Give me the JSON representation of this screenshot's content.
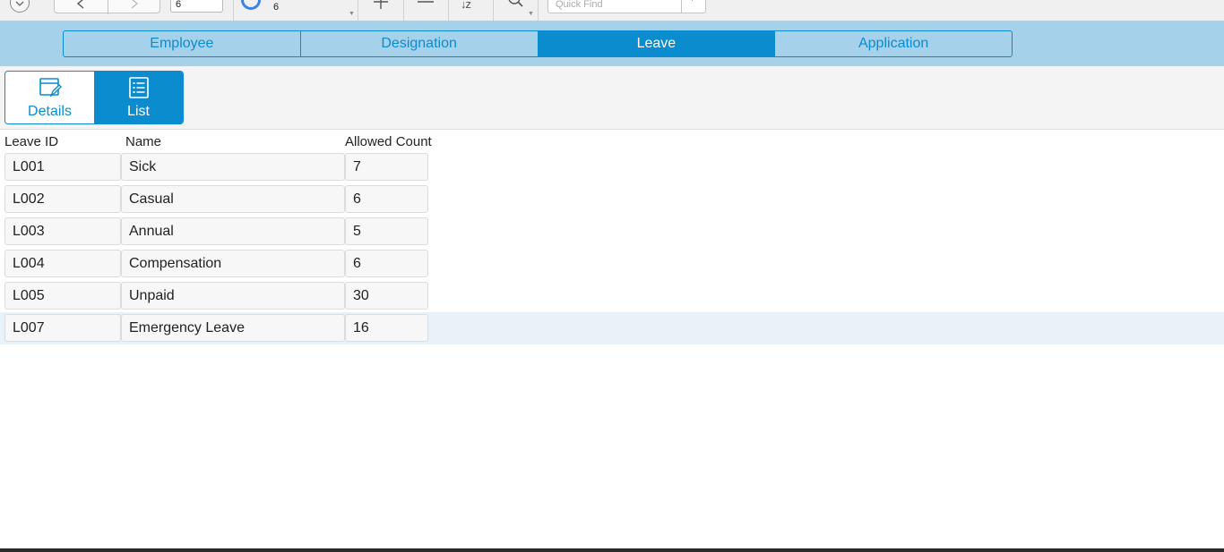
{
  "toolbar": {
    "record_value": "6",
    "total_records": "6",
    "sort_label": "↓z",
    "quick_find_placeholder": "Quick Find"
  },
  "tabs": [
    {
      "label": "Employee",
      "active": false
    },
    {
      "label": "Designation",
      "active": false
    },
    {
      "label": "Leave",
      "active": true
    },
    {
      "label": "Application",
      "active": false
    }
  ],
  "views": {
    "details": {
      "label": "Details",
      "icon": "form-edit-icon",
      "active": false
    },
    "list": {
      "label": "List",
      "icon": "list-icon",
      "active": true
    }
  },
  "table": {
    "headers": [
      "Leave ID",
      "Name",
      "Allowed Count"
    ],
    "rows": [
      {
        "id": "L001",
        "name": "Sick",
        "count": "7"
      },
      {
        "id": "L002",
        "name": "Casual",
        "count": "6"
      },
      {
        "id": "L003",
        "name": "Annual",
        "count": "5"
      },
      {
        "id": "L004",
        "name": "Compensation",
        "count": "6"
      },
      {
        "id": "L005",
        "name": "Unpaid",
        "count": "30"
      },
      {
        "id": "L007",
        "name": "Emergency Leave",
        "count": "16"
      }
    ],
    "selected_row": "L007"
  },
  "colors": {
    "accent": "#0a8ccf",
    "tab_bar_bg": "#a6d1ea",
    "selected_row_bg": "#e9f1f9"
  }
}
